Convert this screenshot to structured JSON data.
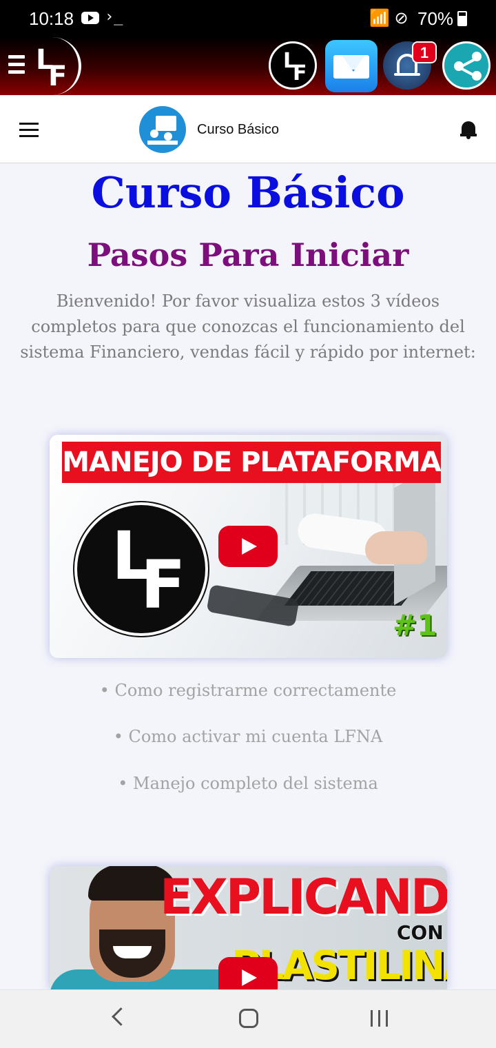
{
  "status_bar": {
    "time": "10:18",
    "terminal_glyph": "›_",
    "battery": "70%"
  },
  "top_bar": {
    "logo_text_l": "L",
    "logo_text_f": "F",
    "notification_count": "1"
  },
  "app_bar": {
    "title": "Curso Básico"
  },
  "page": {
    "heading": "Curso Básico",
    "subheading": "Pasos Para Iniciar",
    "intro": "Bienvenido! Por favor visualiza estos 3 vídeos completos para que conozcas el funcionamiento del sistema Financiero, vendas fácil y rápido por internet:"
  },
  "video1": {
    "banner": "MANEJO DE PLATAFORMA",
    "number": "#1",
    "logo_l": "L",
    "logo_f": "F"
  },
  "bullets": [
    "• Como registrarme correctamente",
    "• Como activar mi cuenta LFNA",
    "• Manejo completo del sistema"
  ],
  "video2": {
    "line1": "EXPLICANDO",
    "line2": "CON",
    "line3": "PLASTILINA"
  },
  "colors": {
    "heading": "#0a0fe0",
    "subheading": "#7d0f7d",
    "banner_red": "#e80f1f",
    "appicon_blue": "#1f8fd8"
  }
}
